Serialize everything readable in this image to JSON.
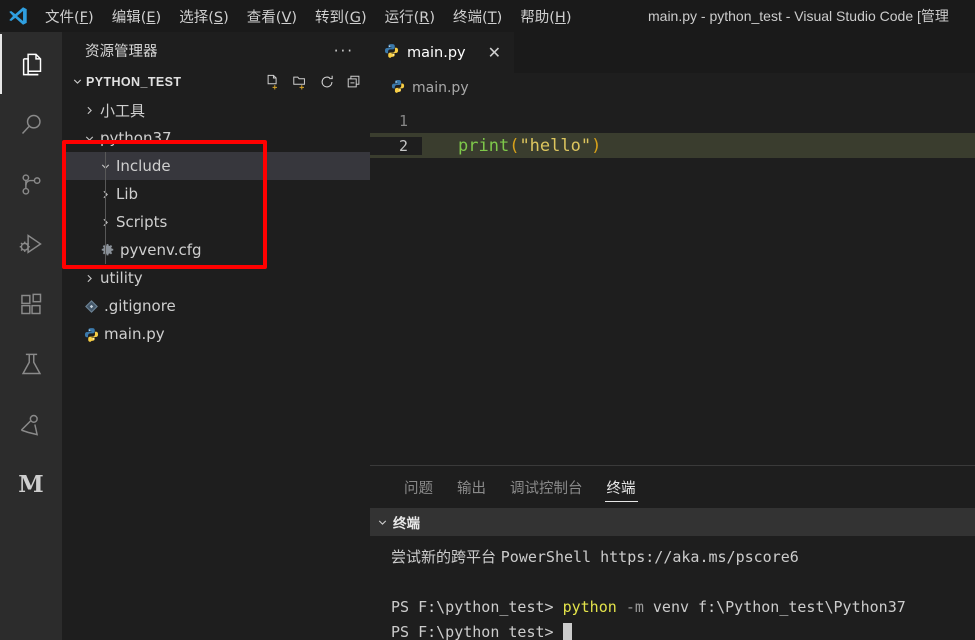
{
  "titlebar": {
    "logo_icon": "vscode-logo-icon",
    "window_title": "main.py - python_test - Visual Studio Code [管理",
    "menus": [
      {
        "label": "文件",
        "acc": "F"
      },
      {
        "label": "编辑",
        "acc": "E"
      },
      {
        "label": "选择",
        "acc": "S"
      },
      {
        "label": "查看",
        "acc": "V"
      },
      {
        "label": "转到",
        "acc": "G"
      },
      {
        "label": "运行",
        "acc": "R"
      },
      {
        "label": "终端",
        "acc": "T"
      },
      {
        "label": "帮助",
        "acc": "H"
      }
    ]
  },
  "activitybar": {
    "items": [
      {
        "name": "explorer",
        "icon": "files-icon",
        "active": true
      },
      {
        "name": "search",
        "icon": "search-icon",
        "active": false
      },
      {
        "name": "source-control",
        "icon": "source-control-icon",
        "active": false
      },
      {
        "name": "run-and-debug",
        "icon": "run-debug-icon",
        "active": false
      },
      {
        "name": "extensions",
        "icon": "extensions-icon",
        "active": false
      },
      {
        "name": "testing",
        "icon": "flask-icon",
        "active": false
      },
      {
        "name": "live-share",
        "icon": "live-share-icon",
        "active": false
      },
      {
        "name": "markdown",
        "icon": "letter-m-icon",
        "active": false,
        "letter": "M"
      }
    ]
  },
  "sidebar": {
    "title": "资源管理器",
    "more_actions": "···",
    "section": {
      "title": "PYTHON_TEST",
      "actions": [
        {
          "name": "new-file",
          "icon": "new-file-icon"
        },
        {
          "name": "new-folder",
          "icon": "new-folder-icon"
        },
        {
          "name": "refresh",
          "icon": "refresh-icon"
        },
        {
          "name": "collapse-all",
          "icon": "collapse-all-icon"
        }
      ]
    },
    "tree": [
      {
        "label": "小工具",
        "type": "folder",
        "state": "collapsed",
        "depth": 1,
        "selected": false,
        "icon": "chevron-right-icon"
      },
      {
        "label": "python37",
        "type": "folder",
        "state": "expanded",
        "depth": 1,
        "selected": false,
        "icon": "chevron-down-icon"
      },
      {
        "label": "Include",
        "type": "folder",
        "state": "expanded",
        "depth": 2,
        "selected": true,
        "icon": "chevron-down-icon"
      },
      {
        "label": "Lib",
        "type": "folder",
        "state": "collapsed",
        "depth": 2,
        "selected": false,
        "icon": "chevron-right-icon"
      },
      {
        "label": "Scripts",
        "type": "folder",
        "state": "collapsed",
        "depth": 2,
        "selected": false,
        "icon": "chevron-right-icon"
      },
      {
        "label": "pyvenv.cfg",
        "type": "file",
        "state": "none",
        "depth": 2,
        "selected": false,
        "icon": "gear-file-icon"
      },
      {
        "label": "utility",
        "type": "folder",
        "state": "collapsed",
        "depth": 1,
        "selected": false,
        "icon": "chevron-right-icon"
      },
      {
        "label": ".gitignore",
        "type": "file",
        "state": "none",
        "depth": 1,
        "selected": false,
        "icon": "git-file-icon"
      },
      {
        "label": "main.py",
        "type": "file",
        "state": "none",
        "depth": 1,
        "selected": false,
        "icon": "python-file-icon"
      }
    ],
    "annotation": {
      "name": "red-highlight-box",
      "color": "#ff0000"
    }
  },
  "editor": {
    "tab": {
      "label": "main.py",
      "icon": "python-file-icon",
      "close_icon": "close-icon"
    },
    "breadcrumb": {
      "label": "main.py",
      "icon": "python-file-icon"
    },
    "lines": [
      {
        "number": "1",
        "current": false,
        "tokens": []
      },
      {
        "number": "2",
        "current": true,
        "tokens": [
          {
            "text": "print",
            "kind": "fn"
          },
          {
            "text": "(",
            "kind": "paren"
          },
          {
            "text": "\"hello\"",
            "kind": "str"
          },
          {
            "text": ")",
            "kind": "paren"
          }
        ]
      }
    ]
  },
  "panel": {
    "tabs": [
      {
        "label": "问题",
        "active": false
      },
      {
        "label": "输出",
        "active": false
      },
      {
        "label": "调试控制台",
        "active": false
      },
      {
        "label": "终端",
        "active": true
      }
    ],
    "terminal_section_title": "终端",
    "terminal_section_chevron": "chevron-down-icon",
    "terminal_lines": [
      {
        "segments": [
          {
            "text": "尝试新的跨平台 ",
            "kind": "cjk"
          },
          {
            "text": "PowerShell https://aka.ms/pscore6",
            "kind": "plain"
          }
        ]
      },
      {
        "segments": []
      },
      {
        "segments": [
          {
            "text": "PS F:\\python_test> ",
            "kind": "plain"
          },
          {
            "text": "python",
            "kind": "cmd"
          },
          {
            "text": " ",
            "kind": "plain"
          },
          {
            "text": "-m",
            "kind": "flag"
          },
          {
            "text": " venv f:\\Python_test\\Python37",
            "kind": "plain"
          }
        ]
      },
      {
        "segments": [
          {
            "text": "PS F:\\python_test> ",
            "kind": "plain"
          }
        ],
        "cursor": true
      }
    ]
  }
}
